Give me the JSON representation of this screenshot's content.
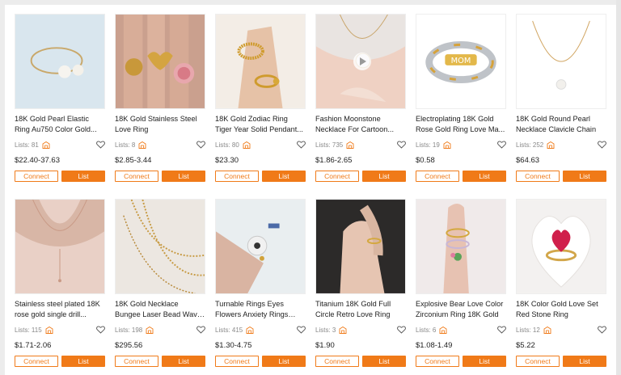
{
  "accent": "#f07a18",
  "products": [
    {
      "title": "18K Gold Pearl Elastic Ring Au750 Color Gold...",
      "lists_label": "Lists: 81",
      "price": "$22.40-37.63",
      "image": "pearl-ring-on-blue",
      "video": false
    },
    {
      "title": "18K Gold Stainless Steel Love Ring",
      "lists_label": "Lists: 8",
      "price": "$2.85-3.44",
      "image": "heart-rings-on-hand",
      "video": false
    },
    {
      "title": "18K Gold Zodiac Ring Tiger Year Solid Pendant...",
      "lists_label": "Lists: 80",
      "price": "$23.30",
      "image": "zodiac-rings-on-hand",
      "video": false
    },
    {
      "title": "Fashion Moonstone Necklace For Cartoon...",
      "lists_label": "Lists: 735",
      "price": "$1.86-2.65",
      "image": "moonstone-necklace",
      "video": true
    },
    {
      "title": "Electroplating 18K Gold Rose Gold Ring Love Ma...",
      "lists_label": "Lists: 19",
      "price": "$0.58",
      "image": "mom-ring-silver",
      "video": false
    },
    {
      "title": "18K Gold Round Pearl Necklace Clavicle Chain",
      "lists_label": "Lists: 252",
      "price": "$64.63",
      "image": "pearl-pendant-necklace",
      "video": false
    },
    {
      "title": "Stainless steel plated 18K rose gold single drill...",
      "lists_label": "Lists: 115",
      "price": "$1.71-2.06",
      "image": "rose-gold-drop-necklace",
      "video": false
    },
    {
      "title": "18K Gold Necklace Bungee Laser Bead Wave Bead...",
      "lists_label": "Lists: 198",
      "price": "$295.56",
      "image": "bead-chain-necklaces",
      "video": false
    },
    {
      "title": "Turnable Rings Eyes Flowers Anxiety Rings For...",
      "lists_label": "Lists: 415",
      "price": "$1.30-4.75",
      "image": "eye-ring-in-fingers",
      "video": false
    },
    {
      "title": "Titanium 18K Gold Full Circle Retro Love Ring",
      "lists_label": "Lists: 3",
      "price": "$1.90",
      "image": "gold-ring-on-hand",
      "video": false
    },
    {
      "title": "Explosive Bear Love Color Zirconium Ring 18K Gold",
      "lists_label": "Lists: 6",
      "price": "$1.08-1.49",
      "image": "bear-ring-on-finger",
      "video": false
    },
    {
      "title": "18K Color Gold Love Set Red Stone Ring",
      "lists_label": "Lists: 12",
      "price": "$5.22",
      "image": "red-heart-ring",
      "video": false
    }
  ],
  "buttons": {
    "connect": "Connect",
    "list": "List"
  }
}
